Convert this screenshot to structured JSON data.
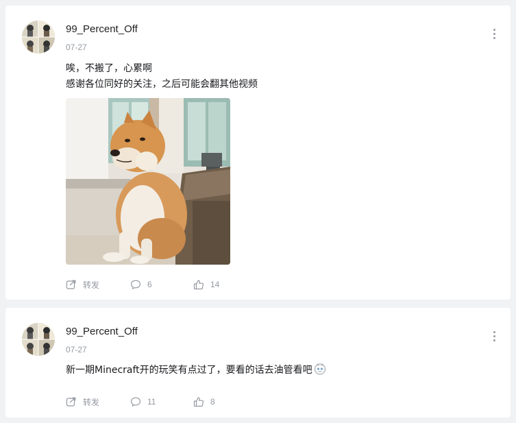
{
  "posts": [
    {
      "username": "99_Percent_Off",
      "date": "07-27",
      "lines": [
        "唉，不搬了，心累啊",
        "感谢各位同好的关注，之后可能会翻其他视频"
      ],
      "has_image": true,
      "image_subject": "shiba-inu-dog-photo",
      "actions": {
        "forward_label": "转发",
        "comment_count": "6",
        "like_count": "14"
      }
    },
    {
      "username": "99_Percent_Off",
      "date": "07-27",
      "lines": [
        "新一期Minecraft开的玩笑有点过了，要看的话去油管看吧"
      ],
      "has_image": false,
      "emoji": "smirk-face-emoji",
      "actions": {
        "forward_label": "转发",
        "comment_count": "11",
        "like_count": "8"
      }
    }
  ],
  "icons": {
    "more": "more-vertical-icon",
    "forward": "forward-icon",
    "comment": "comment-icon",
    "like": "thumbs-up-icon"
  },
  "colors": {
    "background": "#f1f2f3",
    "card": "#ffffff",
    "text": "#18191c",
    "muted": "#9499a0"
  }
}
